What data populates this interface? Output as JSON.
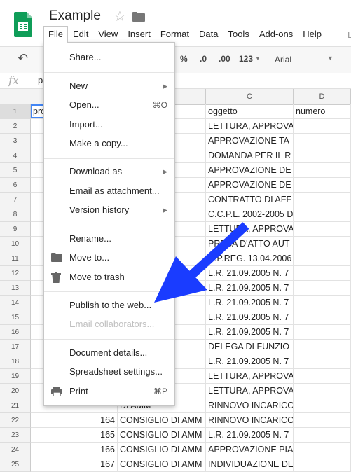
{
  "header": {
    "title": "Example",
    "menus": [
      "File",
      "Edit",
      "View",
      "Insert",
      "Format",
      "Data",
      "Tools",
      "Add-ons",
      "Help"
    ],
    "active_menu": "File",
    "edge": "L"
  },
  "toolbar": {
    "percent": "%",
    "dec_decrease": ".0",
    "dec_increase": ".00",
    "more_formats": "123",
    "font": "Arial"
  },
  "formula_bar": {
    "fx": "fx",
    "content": "p"
  },
  "grid": {
    "columns": [
      "C",
      "D"
    ],
    "rows": [
      {
        "n": "1",
        "a": "pro",
        "b": "",
        "c": "oggetto",
        "d": "numero"
      },
      {
        "n": "2",
        "a": "",
        "b": "DI AMM",
        "c": "LETTURA, APPROVA",
        "d": ""
      },
      {
        "n": "3",
        "a": "",
        "b": "DI AMM",
        "c": "APPROVAZIONE TA",
        "d": ""
      },
      {
        "n": "4",
        "a": "",
        "b": "DI AMM",
        "c": "DOMANDA PER IL R",
        "d": ""
      },
      {
        "n": "5",
        "a": "",
        "b": "DI AMM",
        "c": "APPROVAZIONE DE",
        "d": ""
      },
      {
        "n": "6",
        "a": "",
        "b": "DI AMM",
        "c": "APPROVAZIONE DE",
        "d": ""
      },
      {
        "n": "7",
        "a": "",
        "b": "DI AMM",
        "c": "CONTRATTO DI AFF",
        "d": ""
      },
      {
        "n": "8",
        "a": "",
        "b": "DI AMM",
        "c": "C.C.P.L. 2002-2005 D",
        "d": ""
      },
      {
        "n": "9",
        "a": "",
        "b": "DI AMM",
        "c": "LETTURA, APPROVA",
        "d": ""
      },
      {
        "n": "10",
        "a": "",
        "b": "DI AMM",
        "c": "PRESA D'ATTO AUT",
        "d": ""
      },
      {
        "n": "11",
        "a": "",
        "b": "DI AMM",
        "c": "D.P.REG. 13.04.2006",
        "d": ""
      },
      {
        "n": "12",
        "a": "",
        "b": "DI AMM",
        "c": "L.R. 21.09.2005 N. 7",
        "d": ""
      },
      {
        "n": "13",
        "a": "",
        "b": "DI AMM",
        "c": "L.R. 21.09.2005 N. 7",
        "d": ""
      },
      {
        "n": "14",
        "a": "",
        "b": "DI AMM",
        "c": "L.R. 21.09.2005 N. 7",
        "d": ""
      },
      {
        "n": "15",
        "a": "",
        "b": "DI AMM",
        "c": "L.R. 21.09.2005 N. 7",
        "d": ""
      },
      {
        "n": "16",
        "a": "",
        "b": "DI AMM",
        "c": "L.R. 21.09.2005 N. 7",
        "d": ""
      },
      {
        "n": "17",
        "a": "",
        "b": "DI AMM",
        "c": "DELEGA DI FUNZIO",
        "d": ""
      },
      {
        "n": "18",
        "a": "",
        "b": "DI AMM",
        "c": "L.R. 21.09.2005 N. 7",
        "d": ""
      },
      {
        "n": "19",
        "a": "",
        "b": "DI AMM",
        "c": "LETTURA, APPROVA",
        "d": ""
      },
      {
        "n": "20",
        "a": "",
        "b": "DI AMM",
        "c": "LETTURA, APPROVA",
        "d": ""
      },
      {
        "n": "21",
        "a": "",
        "b": "DI AMM",
        "c": "RINNOVO INCARICO",
        "d": ""
      },
      {
        "n": "22",
        "a": "164",
        "b": "CONSIGLIO DI AMM",
        "c": "RINNOVO INCARICO",
        "d": ""
      },
      {
        "n": "23",
        "a": "165",
        "b": "CONSIGLIO DI AMM",
        "c": "L.R. 21.09.2005 N. 7",
        "d": ""
      },
      {
        "n": "24",
        "a": "166",
        "b": "CONSIGLIO DI AMM",
        "c": "APPROVAZIONE PIA",
        "d": ""
      },
      {
        "n": "25",
        "a": "167",
        "b": "CONSIGLIO DI AMM",
        "c": "INDIVIDUAZIONE DE",
        "d": ""
      }
    ]
  },
  "file_menu": {
    "share": "Share...",
    "new": "New",
    "open": "Open...",
    "open_shortcut": "⌘O",
    "import": "Import...",
    "make_copy": "Make a copy...",
    "download_as": "Download as",
    "email_attachment": "Email as attachment...",
    "version_history": "Version history",
    "rename": "Rename...",
    "move_to": "Move to...",
    "move_to_trash": "Move to trash",
    "publish": "Publish to the web...",
    "email_collaborators": "Email collaborators...",
    "document_details": "Document details...",
    "spreadsheet_settings": "Spreadsheet settings...",
    "print": "Print",
    "print_shortcut": "⌘P"
  },
  "colors": {
    "arrow": "#1a3cff",
    "sheets_green": "#0f9d58",
    "selection": "#4285f4"
  }
}
